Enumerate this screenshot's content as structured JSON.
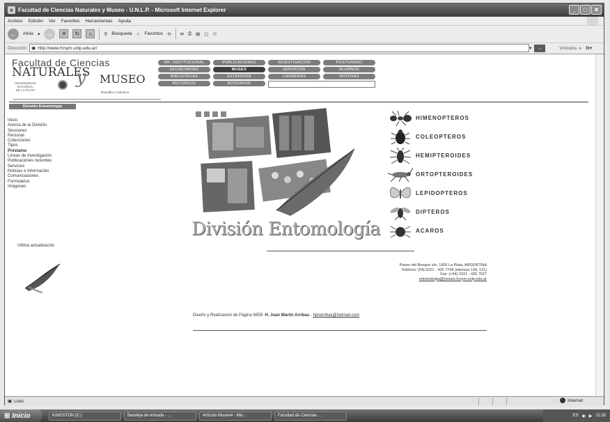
{
  "window": {
    "title": "Facultad de Ciencias Naturales y Museo - U.N.L.P. - Microsoft Internet Explorer",
    "controls": [
      "_",
      "□",
      "✕"
    ]
  },
  "menubar": [
    "Archivo",
    "Edición",
    "Ver",
    "Favoritos",
    "Herramientas",
    "Ayuda"
  ],
  "toolbar": {
    "back_label": "Atrás",
    "search_label": "Búsqueda",
    "favorites_label": "Favoritos"
  },
  "address": {
    "label": "Dirección",
    "url": "http://www.fcnym.unlp.edu.ar/",
    "links_label": "Vínculos"
  },
  "site": {
    "logo_line1": "Facultad de Ciencias",
    "logo_line2": "NATURALES",
    "logo_y": "y",
    "logo_museo": "MUSEO",
    "logo_unlp": [
      "UNIVERSIDAD",
      "NACIONAL",
      "DE LA PLATA"
    ],
    "logo_republica": "República Argentina",
    "nav": [
      {
        "label": "INF. INSTITUCIONAL",
        "active": false
      },
      {
        "label": "PUBLICACIONES",
        "active": false
      },
      {
        "label": "INVESTIGACIÓN",
        "active": false
      },
      {
        "label": "POSTGRADO",
        "active": false
      },
      {
        "label": "SECRETARIAS",
        "active": false
      },
      {
        "label": "MUSEO",
        "active": true
      },
      {
        "label": "SERVICIOS",
        "active": false
      },
      {
        "label": "ALUMNOS",
        "active": false
      },
      {
        "label": "BIBLIOTECAS",
        "active": false
      },
      {
        "label": "EXTENSIÓN",
        "active": false
      },
      {
        "label": "CARRERAS",
        "active": false
      },
      {
        "label": "NOTICIAS",
        "active": false
      },
      {
        "label": "RECURSOS",
        "active": false
      },
      {
        "label": "BUSCADOR",
        "active": false
      }
    ],
    "division_label": "División Entomología",
    "sidenav": [
      {
        "label": "Inicio",
        "current": false
      },
      {
        "label": "Acerca de la División",
        "current": false
      },
      {
        "label": "Secciones",
        "current": false
      },
      {
        "label": "Personal",
        "current": false
      },
      {
        "label": "Colecciones",
        "current": false
      },
      {
        "label": "Tipos",
        "current": false
      },
      {
        "label": "Préstamo",
        "current": true
      },
      {
        "label": "Líneas de Investigación",
        "current": false
      },
      {
        "label": "Publicaciones recientes",
        "current": false
      },
      {
        "label": "Servicios",
        "current": false
      },
      {
        "label": "Noticias e Información",
        "current": false
      },
      {
        "label": "Comunicaciones",
        "current": false
      },
      {
        "label": "Formularios",
        "current": false
      },
      {
        "label": "Imágenes",
        "current": false
      }
    ],
    "last_update_label": "Ultima actualización",
    "division_title": "División Entomología",
    "orders": [
      {
        "name": "HIMENOPTEROS",
        "icon": "ant-icon"
      },
      {
        "name": "COLEOPTEROS",
        "icon": "beetle-icon"
      },
      {
        "name": "HEMIPTEROIDES",
        "icon": "bug-icon"
      },
      {
        "name": "ORTOPTEROIDES",
        "icon": "grasshopper-icon"
      },
      {
        "name": "LEPIDOPTEROS",
        "icon": "butterfly-icon"
      },
      {
        "name": "DIPTEROS",
        "icon": "fly-icon"
      },
      {
        "name": "ACAROS",
        "icon": "mite-icon"
      }
    ],
    "address_lines": [
      "Paseo del Bosque s/n, 1900 La Plata, ARGENTINA",
      "Teléfono: (54) 0221 - 425 7744 (internos 134, 121)",
      "Fax: (+54) 0221 - 425 7527"
    ],
    "email": "entomologia@museo.fcnym.unlp.edu.ar",
    "credits_prefix": "Diseño y Realización de Página WEB:",
    "credits_author": "H. Juan Martín Arribas",
    "credits_sep": " - ",
    "credits_email": "hjmarribas@hotmail.com"
  },
  "status": {
    "text": "Listo",
    "zone": "Internet"
  },
  "taskbar": {
    "start": "Inicio",
    "tasks": [
      "KINGSTON (E:)",
      "Bandeja de entrada - ...",
      "Artículo Museo4 - Mic...",
      "Facultad de Ciencias ..."
    ],
    "lang": "ES",
    "clock": "11:28"
  }
}
